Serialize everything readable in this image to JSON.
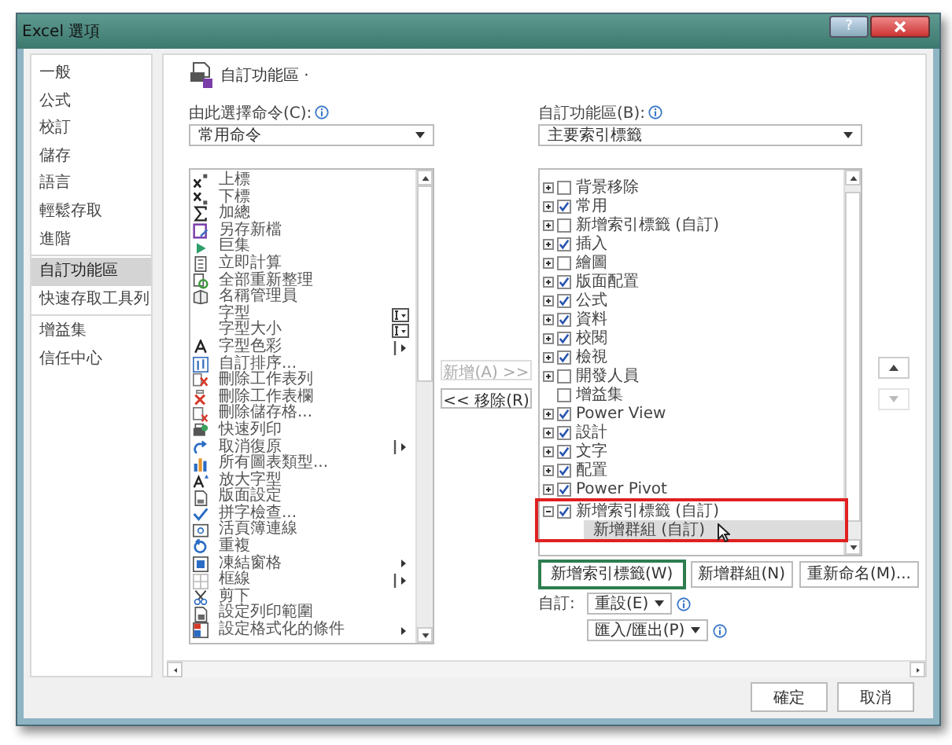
{
  "window": {
    "title": "Excel 選項",
    "help": "?"
  },
  "sidebar": {
    "groups": [
      [
        {
          "label": "一般",
          "selected": false
        },
        {
          "label": "公式",
          "selected": false
        },
        {
          "label": "校訂",
          "selected": false
        },
        {
          "label": "儲存",
          "selected": false
        },
        {
          "label": "語言",
          "selected": false
        },
        {
          "label": "輕鬆存取",
          "selected": false
        },
        {
          "label": "進階",
          "selected": false
        }
      ],
      [
        {
          "label": "自訂功能區",
          "selected": true
        },
        {
          "label": "快速存取工具列",
          "selected": false
        }
      ],
      [
        {
          "label": "增益集",
          "selected": false
        },
        {
          "label": "信任中心",
          "selected": false
        }
      ]
    ]
  },
  "header": {
    "title": "自訂功能區 ·"
  },
  "commands": {
    "label": "由此選擇命令(C):",
    "dropdown": "常用命令",
    "items": [
      {
        "label": "上標",
        "kind": "plain"
      },
      {
        "label": "下標",
        "kind": "plain"
      },
      {
        "label": "加總",
        "kind": "plain"
      },
      {
        "label": "另存新檔",
        "kind": "plain"
      },
      {
        "label": "巨集",
        "kind": "plain"
      },
      {
        "label": "立即計算",
        "kind": "plain"
      },
      {
        "label": "全部重新整理",
        "kind": "plain"
      },
      {
        "label": "名稱管理員",
        "kind": "plain"
      },
      {
        "label": "字型",
        "kind": "combo"
      },
      {
        "label": "字型大小",
        "kind": "combo"
      },
      {
        "label": "字型色彩",
        "kind": "split"
      },
      {
        "label": "自訂排序...",
        "kind": "plain"
      },
      {
        "label": "刪除工作表列",
        "kind": "plain"
      },
      {
        "label": "刪除工作表欄",
        "kind": "plain"
      },
      {
        "label": "刪除儲存格...",
        "kind": "plain"
      },
      {
        "label": "快速列印",
        "kind": "plain"
      },
      {
        "label": "取消復原",
        "kind": "split"
      },
      {
        "label": "所有圖表類型...",
        "kind": "plain"
      },
      {
        "label": "放大字型",
        "kind": "plain"
      },
      {
        "label": "版面設定",
        "kind": "plain"
      },
      {
        "label": "拼字檢查...",
        "kind": "plain"
      },
      {
        "label": "活頁簿連線",
        "kind": "plain"
      },
      {
        "label": "重複",
        "kind": "plain"
      },
      {
        "label": "凍結窗格",
        "kind": "submenu"
      },
      {
        "label": "框線",
        "kind": "split"
      },
      {
        "label": "剪下",
        "kind": "plain"
      },
      {
        "label": "設定列印範圍",
        "kind": "plain"
      },
      {
        "label": "設定格式化的條件",
        "kind": "submenu"
      }
    ]
  },
  "middle_buttons": [
    {
      "label": "新增(A) >>",
      "disabled": true
    },
    {
      "label": "<< 移除(R)",
      "disabled": false
    }
  ],
  "ribbon": {
    "label": "自訂功能區(B):",
    "dropdown": "主要索引標籤",
    "tabs": [
      {
        "label": "背景移除",
        "kind": "collapsed",
        "checked": false,
        "selected": false
      },
      {
        "label": "常用",
        "kind": "collapsed",
        "checked": true,
        "selected": false
      },
      {
        "label": "新增索引標籤 (自訂)",
        "kind": "collapsed",
        "checked": false,
        "selected": false
      },
      {
        "label": "插入",
        "kind": "collapsed",
        "checked": true,
        "selected": false
      },
      {
        "label": "繪圖",
        "kind": "collapsed",
        "checked": false,
        "selected": false
      },
      {
        "label": "版面配置",
        "kind": "collapsed",
        "checked": true,
        "selected": false
      },
      {
        "label": "公式",
        "kind": "collapsed",
        "checked": true,
        "selected": false
      },
      {
        "label": "資料",
        "kind": "collapsed",
        "checked": true,
        "selected": false
      },
      {
        "label": "校閱",
        "kind": "collapsed",
        "checked": true,
        "selected": false
      },
      {
        "label": "檢視",
        "kind": "collapsed",
        "checked": true,
        "selected": false
      },
      {
        "label": "開發人員",
        "kind": "collapsed",
        "checked": false,
        "selected": false
      },
      {
        "label": "增益集",
        "kind": "leaf",
        "checked": false,
        "selected": false
      },
      {
        "label": "Power View",
        "kind": "collapsed",
        "checked": true,
        "selected": false
      },
      {
        "label": "設計",
        "kind": "collapsed",
        "checked": true,
        "selected": false
      },
      {
        "label": "文字",
        "kind": "collapsed",
        "checked": true,
        "selected": false
      },
      {
        "label": "配置",
        "kind": "collapsed",
        "checked": true,
        "selected": false
      },
      {
        "label": "Power Pivot",
        "kind": "collapsed",
        "checked": true,
        "selected": false
      },
      {
        "label": "新增索引標籤 (自訂)",
        "kind": "expanded",
        "checked": true,
        "selected": false,
        "highlighted": true,
        "children": [
          {
            "label": "新增群組 (自訂)",
            "selected": true
          }
        ]
      }
    ],
    "buttons": [
      {
        "label": "新增索引標籤(W)",
        "focused": true
      },
      {
        "label": "新增群組(N)",
        "focused": false
      },
      {
        "label": "重新命名(M)...",
        "focused": false
      }
    ],
    "customize_label": "自訂:",
    "reset": "重設(E)",
    "import_export": "匯入/匯出(P)"
  },
  "footer_buttons": [
    "確定",
    "取消"
  ]
}
